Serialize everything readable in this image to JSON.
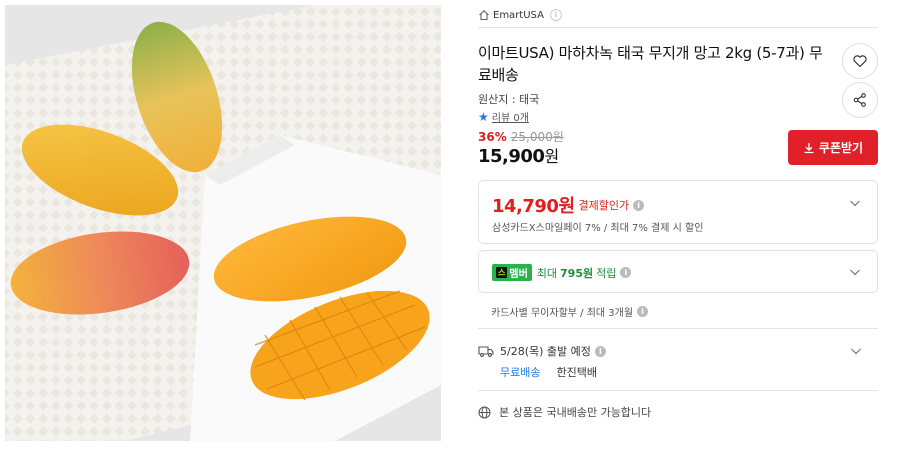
{
  "seller": {
    "name": "EmartUSA",
    "info": "i"
  },
  "product": {
    "title": "이마트USA) 마하차녹 태국 무지개 망고 2kg (5-7과) 무료배송",
    "origin": "원산지 : 태국",
    "review": "리뷰 0개",
    "discount_rate": "36%",
    "original_price": "25,000원",
    "price_number": "15,900",
    "price_unit": "원"
  },
  "buttons": {
    "coupon_label": "쿠폰받기"
  },
  "payment": {
    "price": "14,790원",
    "label": "결제할인가",
    "description": "삼성카드X스마일페이 7% / 최대 7% 결제 시 할인"
  },
  "membership": {
    "badge_mark": "스",
    "badge_label": "멤버",
    "max_label": "최대",
    "points": "795원",
    "earn_label": "적립"
  },
  "installment": {
    "text": "카드사별 무이자할부 / 최대 3개월"
  },
  "shipping": {
    "date_text": "5/28(목) 출발 예정",
    "free_label": "무료배송",
    "courier": "한진택배"
  },
  "notice": {
    "domestic_text": "본 상품은 국내배송만 가능합니다"
  },
  "colors": {
    "accent_red": "#e0212a",
    "link_blue": "#1e7be0",
    "member_green": "#2bb24c"
  },
  "icons": [
    "home-icon",
    "info-icon",
    "heart-icon",
    "share-icon",
    "star-icon",
    "download-icon",
    "chevron-down-icon",
    "truck-icon",
    "globe-icon"
  ]
}
